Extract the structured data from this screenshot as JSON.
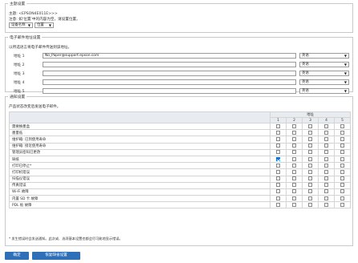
{
  "subject_section": {
    "legend": "主题设置",
    "subject_line": "主题: <EPSON4E011E>>>",
    "note": "注意: 如‘位置’中的内容为空，请设置位置。",
    "select_left": "设备名称",
    "select_right": "位置"
  },
  "email_section": {
    "legend": "电子邮件地址设置",
    "description": "以所选语言将电子邮件传送到该地址。",
    "rows": [
      {
        "label": "地址 1",
        "value": "No_Paper@support.epson.com",
        "lang": "英语"
      },
      {
        "label": "地址 2",
        "value": "",
        "lang": "英语"
      },
      {
        "label": "地址 3",
        "value": "",
        "lang": "英语"
      },
      {
        "label": "地址 4",
        "value": "",
        "lang": "英语"
      },
      {
        "label": "地址 5",
        "value": "",
        "lang": "英语"
      }
    ]
  },
  "notify_section": {
    "legend": "通知设置",
    "description": "产品状态改变后发送电子邮件。",
    "address_header": "地址",
    "columns": [
      "1",
      "2",
      "3",
      "4",
      "5"
    ],
    "rows": [
      {
        "label": "需要换墨盒",
        "checked": [
          false,
          false,
          false,
          false,
          false
        ]
      },
      {
        "label": "墨量低",
        "checked": [
          false,
          false,
          false,
          false,
          false
        ]
      },
      {
        "label": "维护箱: 已到使用寿命",
        "checked": [
          false,
          false,
          false,
          false,
          false
        ]
      },
      {
        "label": "维护箱: 接近使用寿命",
        "checked": [
          false,
          false,
          false,
          false,
          false
        ]
      },
      {
        "label": "管理员密码已更改",
        "checked": [
          false,
          false,
          false,
          false,
          false
        ]
      },
      {
        "label": "缺纸",
        "checked": [
          true,
          false,
          false,
          false,
          false
        ]
      },
      {
        "label": "打印已停止*",
        "checked": [
          false,
          false,
          false,
          false,
          false
        ]
      },
      {
        "label": "打印机错误",
        "checked": [
          false,
          false,
          false,
          false,
          false
        ]
      },
      {
        "label": "扫描仪错误",
        "checked": [
          false,
          false,
          false,
          false,
          false
        ]
      },
      {
        "label": "传真错误",
        "checked": [
          false,
          false,
          false,
          false,
          false
        ]
      },
      {
        "label": "Wi-Fi 故障",
        "checked": [
          false,
          false,
          false,
          false,
          false
        ]
      },
      {
        "label": "内置 SD 卡 故障",
        "checked": [
          false,
          false,
          false,
          false,
          false
        ]
      },
      {
        "label": "PDL 板 故障",
        "checked": [
          false,
          false,
          false,
          false,
          false
        ]
      }
    ],
    "footnote": "* 发生错误时会发送通知。此次或、选项基本设置也都会尽可能地显示错误。"
  },
  "buttons": {
    "ok": "确定",
    "restore": "恢复缺省设置"
  },
  "colors": {
    "button": "#2f6fb7",
    "checked": "#1a73c9"
  }
}
